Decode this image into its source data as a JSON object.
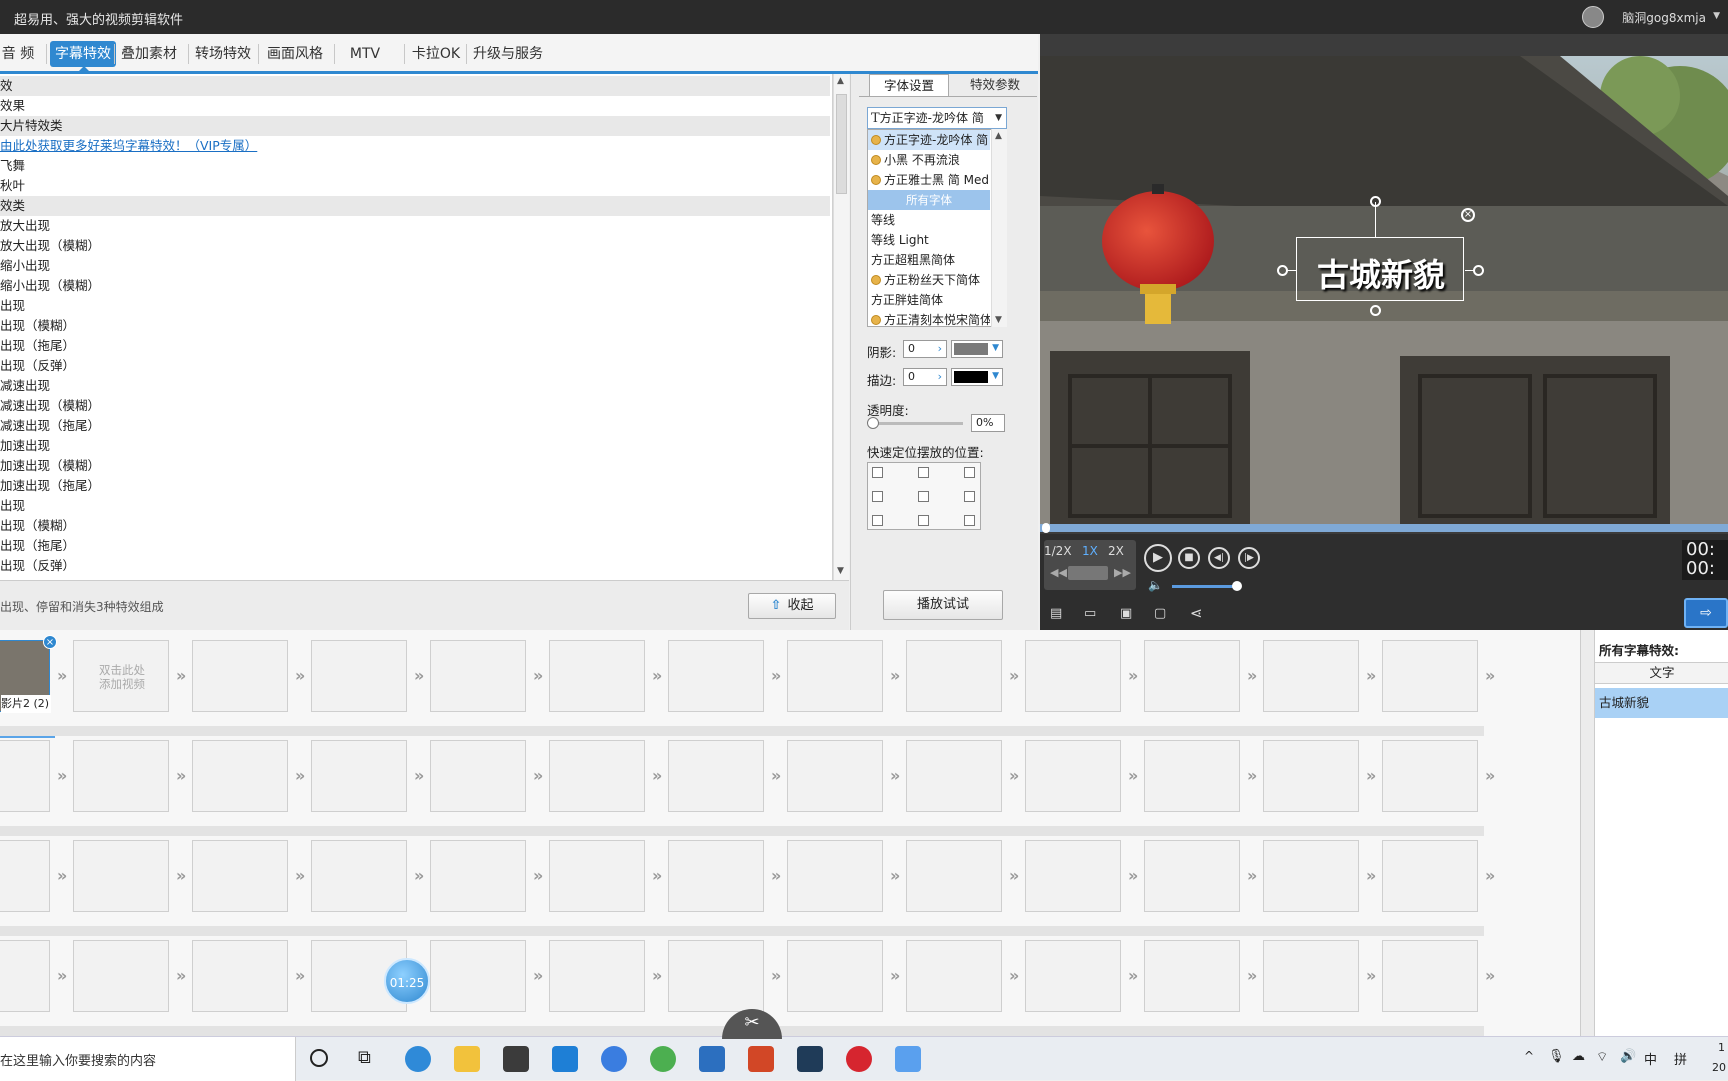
{
  "title": "超易用、强大的视频剪辑软件",
  "user": "脑洞gog8xmja",
  "tabs": [
    "音 频",
    "字幕特效",
    "叠加素材",
    "转场特效",
    "画面风格",
    "MTV",
    "卡拉OK",
    "升级与服务"
  ],
  "effects": [
    {
      "text": "效",
      "type": "cat"
    },
    {
      "text": "效果",
      "type": "item"
    },
    {
      "text": "大片特效类",
      "type": "cat"
    },
    {
      "text": "由此处获取更多好莱坞字幕特效！（VIP专属）",
      "type": "link"
    },
    {
      "text": "飞舞",
      "type": "item"
    },
    {
      "text": "秋叶",
      "type": "item"
    },
    {
      "text": "效类",
      "type": "cat"
    },
    {
      "text": "放大出现",
      "type": "item"
    },
    {
      "text": "放大出现（模糊）",
      "type": "item"
    },
    {
      "text": "缩小出现",
      "type": "item"
    },
    {
      "text": "缩小出现（模糊）",
      "type": "item"
    },
    {
      "text": "出现",
      "type": "item"
    },
    {
      "text": "出现（模糊）",
      "type": "item"
    },
    {
      "text": "出现（拖尾）",
      "type": "item"
    },
    {
      "text": "出现（反弹）",
      "type": "item"
    },
    {
      "text": "减速出现",
      "type": "item"
    },
    {
      "text": "减速出现（模糊）",
      "type": "item"
    },
    {
      "text": "减速出现（拖尾）",
      "type": "item"
    },
    {
      "text": "加速出现",
      "type": "item"
    },
    {
      "text": "加速出现（模糊）",
      "type": "item"
    },
    {
      "text": "加速出现（拖尾）",
      "type": "item"
    },
    {
      "text": "出现",
      "type": "item"
    },
    {
      "text": "出现（模糊）",
      "type": "item"
    },
    {
      "text": "出现（拖尾）",
      "type": "item"
    },
    {
      "text": "出现（反弹）",
      "type": "item"
    }
  ],
  "list_footer": {
    "desc": "出现、停留和消失3种特效组成",
    "collapse": "收起",
    "play_test": "播放试试"
  },
  "props": {
    "tab_font": "字体设置",
    "tab_effect": "特效参数",
    "font_selected": "方正字迹-龙吟体 简",
    "fonts": [
      {
        "name": "方正字迹-龙吟体 简",
        "coin": true,
        "sel": true
      },
      {
        "name": "小黑 不再流浪",
        "coin": true
      },
      {
        "name": "方正雅士黑 简 Medi",
        "coin": true
      },
      {
        "name": "所有字体",
        "hdr": true
      },
      {
        "name": "等线"
      },
      {
        "name": "等线 Light"
      },
      {
        "name": "方正超粗黑简体"
      },
      {
        "name": "方正粉丝天下简体",
        "coin": true
      },
      {
        "name": "方正胖娃简体"
      },
      {
        "name": "方正清刻本悦宋简体",
        "coin": true
      }
    ],
    "shadow_label": "阴影:",
    "shadow_value": "0",
    "shadow_color": "#7a7a7a",
    "stroke_label": "描边:",
    "stroke_value": "0",
    "stroke_color": "#000000",
    "opacity_label": "透明度:",
    "opacity_value": "0%",
    "position_label": "快速定位摆放的位置:"
  },
  "preview": {
    "caption": "古城新貌",
    "speeds": [
      "1/2X",
      "1X",
      "2X"
    ],
    "time1": "00:",
    "time2": "00:"
  },
  "timeline": {
    "clip_label": "影片2 (2)",
    "add_hint": "双击此处\n添加视频",
    "badge_time": "01:25"
  },
  "right_panel": {
    "title": "所有字幕特效:",
    "col_text": "文字",
    "row_text": "古城新貌"
  },
  "taskbar": {
    "search_placeholder": "在这里输入你要搜索的内容",
    "ime1": "中",
    "ime2": "拼",
    "time_partial": "1",
    "date_partial": "20"
  }
}
